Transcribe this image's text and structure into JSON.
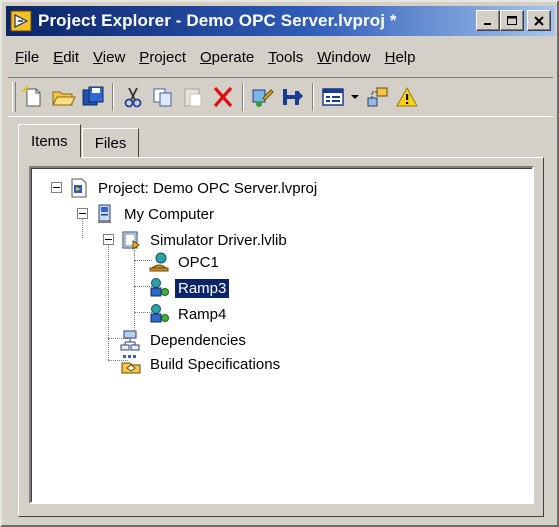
{
  "window": {
    "title": "Project Explorer - Demo OPC Server.lvproj *",
    "app_icon": "labview-project-icon",
    "minimize_icon": "minimize-icon",
    "maximize_icon": "maximize-icon",
    "close_icon": "close-icon"
  },
  "menu": [
    {
      "first": "F",
      "rest": "ile"
    },
    {
      "first": "E",
      "rest": "dit"
    },
    {
      "first": "V",
      "rest": "iew"
    },
    {
      "first": "P",
      "rest": "roject"
    },
    {
      "first": "O",
      "rest": "perate"
    },
    {
      "first": "T",
      "rest": "ools"
    },
    {
      "first": "W",
      "rest": "indow"
    },
    {
      "first": "H",
      "rest": "elp"
    }
  ],
  "toolbar": {
    "icons": [
      "new-icon",
      "open-icon",
      "save-all-icon",
      "cut-icon",
      "copy-icon",
      "paste-icon",
      "delete-icon",
      "build-icon",
      "deploy-icon",
      "view-toggle-icon",
      "dropdown-arrow-icon",
      "add-to-project-icon",
      "warning-icon"
    ]
  },
  "tabs": {
    "items": "Items",
    "files": "Files"
  },
  "tree": {
    "project": "Project: Demo OPC Server.lvproj",
    "computer": "My Computer",
    "library": "Simulator Driver.lvlib",
    "opc1": "OPC1",
    "ramp3": "Ramp3",
    "ramp4": "Ramp4",
    "dependencies": "Dependencies",
    "build_specs": "Build Specifications",
    "selected": "Ramp3"
  },
  "colors": {
    "titlebar_start": "#0a2468",
    "titlebar_end": "#a6c4ee",
    "selection": "#0a246a",
    "face": "#d4d0c8"
  }
}
